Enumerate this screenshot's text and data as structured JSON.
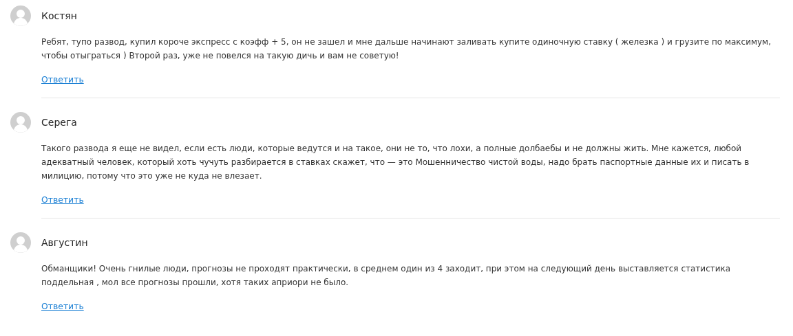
{
  "comments": [
    {
      "author": "Костян",
      "text": "Ребят, тупо развод, купил короче экспресс с коэфф + 5, он не зашел и мне дальше начинают заливать купите одиночную ставку ( железка ) и грузите по максимум, чтобы отыграться ) Второй раз, уже не повелся на такую дичь и вам не советую!",
      "reply": "Ответить"
    },
    {
      "author": "Серега",
      "text": "Такого развода я еще не видел, если есть люди, которые ведутся и на такое, они не то, что лохи, а полные долбаебы и не должны жить. Мне кажется, любой адекватный человек, который хоть чучуть разбирается в ставках скажет, что — это Мошенничество чистой воды, надо брать паспортные данные их и писать в милицию, потому что это уже не куда не влезает.",
      "reply": "Ответить"
    },
    {
      "author": "Августин",
      "text": "Обманщики! Очень гнилые люди, прогнозы не проходят практически, в среднем один из 4 заходит, при этом на следующий день выставляется статистика поддельная , мол все прогнозы прошли, хотя таких априори не было.",
      "reply": "Ответить"
    }
  ]
}
